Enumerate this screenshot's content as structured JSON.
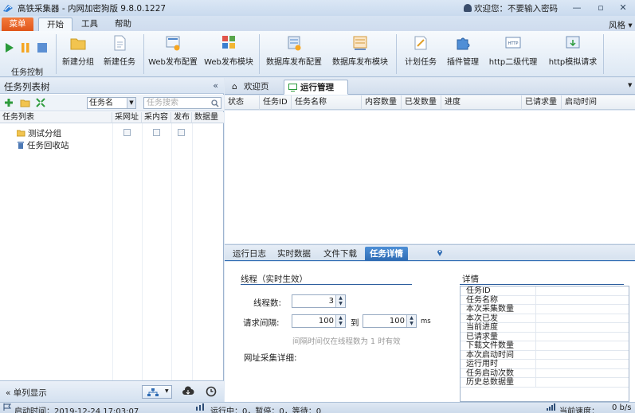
{
  "window": {
    "title": "高铁采集器 - 内网加密狗版 9.8.0.1227",
    "user_text": "欢迎您：不要输入密码",
    "controls": [
      "minimize",
      "maximize",
      "close"
    ]
  },
  "menu": {
    "button": "菜单",
    "tabs": [
      "开始",
      "工具",
      "帮助"
    ],
    "active_tab": "开始",
    "style": "风格"
  },
  "ribbon": {
    "control_group_label": "任务控制",
    "buttons": [
      "新建分组",
      "新建任务",
      "Web发布配置",
      "Web发布模块",
      "数据库发布配置",
      "数据库发布模块",
      "计划任务",
      "插件管理",
      "http二级代理",
      "http模拟请求"
    ]
  },
  "left_panel": {
    "title": "任务列表树",
    "collapse": "«",
    "filter_select": "任务名",
    "search_placeholder": "任务搜索",
    "columns": [
      "任务列表",
      "采网址",
      "采内容",
      "发布",
      "数据量"
    ],
    "tree": [
      "测试分组",
      "任务回收站"
    ],
    "footer_toggle": "单列显示"
  },
  "main_tabs": {
    "welcome": "欢迎页",
    "running": "运行管理"
  },
  "run_table": {
    "columns": [
      "状态",
      "任务ID",
      "任务名称",
      "内容数量",
      "已发数量",
      "进度",
      "已请求量",
      "启动时间"
    ]
  },
  "bottom_tabs": [
    "运行日志",
    "实时数据",
    "文件下载",
    "任务详情"
  ],
  "bottom_active": "任务详情",
  "thread_panel": {
    "title": "线程（实时生效）",
    "threads_label": "线程数:",
    "threads_value": "3",
    "interval_label": "请求间隔:",
    "interval_from": "100",
    "to_label": "到",
    "interval_to": "100",
    "unit": "ms",
    "hint": "间隔时间仅在线程数为 1 时有效",
    "url_detail_label": "网址采集详细:"
  },
  "detail_panel": {
    "title": "详情",
    "rows": [
      "任务ID",
      "任务名称",
      "本次采集数量",
      "本次已发",
      "当前进度",
      "已请求量",
      "下载文件数量",
      "本次启动时间",
      "运行用时",
      "任务启动次数",
      "历史总数据量"
    ]
  },
  "status": {
    "start_time": "启动时间：2019-12-24 17:03:07",
    "run_status": "运行中：0，暂停：0，等待：0",
    "speed_label": "当前速度：",
    "speed_value": "0 b/s"
  },
  "colors": {
    "accent_blue": "#2e6bb3",
    "menu_orange": "#e8632a",
    "play_green": "#2a9a3a",
    "pause_orange": "#f5a623"
  }
}
